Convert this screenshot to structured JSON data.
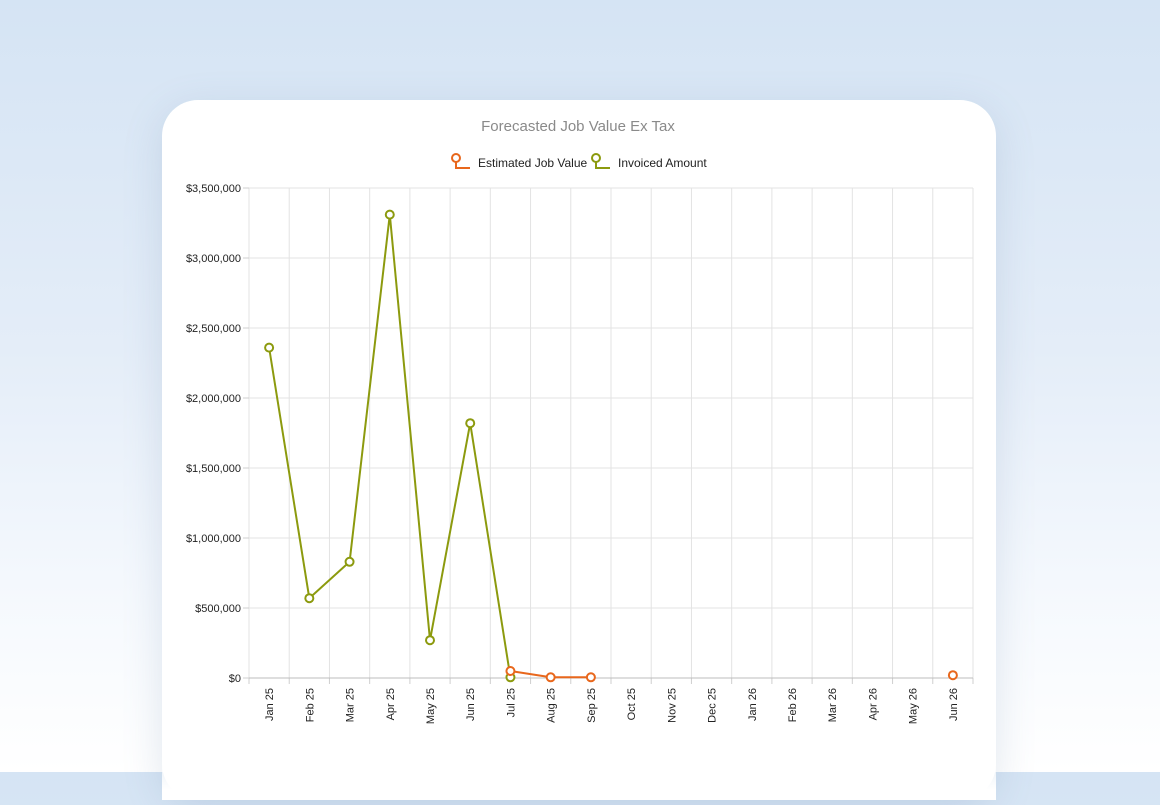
{
  "colors": {
    "estimated": "#e8671c",
    "invoiced": "#8c9a0e",
    "grid": "#e3e3e3",
    "title": "#8a8a8a"
  },
  "chart_data": {
    "type": "line",
    "title": "Forecasted Job Value Ex Tax",
    "xlabel": "",
    "ylabel": "",
    "categories": [
      "Jan 25",
      "Feb 25",
      "Mar 25",
      "Apr 25",
      "May 25",
      "Jun 25",
      "Jul 25",
      "Aug 25",
      "Sep 25",
      "Oct 25",
      "Nov 25",
      "Dec 25",
      "Jan 26",
      "Feb 26",
      "Mar 26",
      "Apr 26",
      "May 26",
      "Jun 26"
    ],
    "ylim": [
      0,
      3500000
    ],
    "yticks": [
      0,
      500000,
      1000000,
      1500000,
      2000000,
      2500000,
      3000000,
      3500000
    ],
    "ytick_labels": [
      "$0",
      "$500,000",
      "$1,000,000",
      "$1,500,000",
      "$2,000,000",
      "$2,500,000",
      "$3,000,000",
      "$3,500,000"
    ],
    "grid": true,
    "legend_position": "top-center",
    "series": [
      {
        "name": "Estimated Job Value",
        "color_key": "estimated",
        "values": [
          null,
          null,
          null,
          null,
          null,
          null,
          50000,
          5000,
          5000,
          null,
          null,
          null,
          null,
          null,
          null,
          null,
          null,
          20000
        ]
      },
      {
        "name": "Invoiced Amount",
        "color_key": "invoiced",
        "values": [
          2360000,
          570000,
          830000,
          3310000,
          270000,
          1820000,
          5000,
          null,
          null,
          null,
          null,
          null,
          null,
          null,
          null,
          null,
          null,
          null
        ]
      }
    ]
  }
}
